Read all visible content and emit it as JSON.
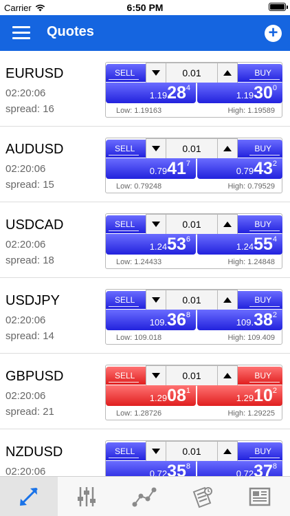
{
  "status_bar": {
    "carrier": "Carrier",
    "time": "6:50 PM"
  },
  "header": {
    "title": "Quotes",
    "menu_icon": "hamburger-menu-icon",
    "add_icon": "plus-circle-icon"
  },
  "colors": {
    "header": "#1565e0",
    "blue_button": "#2b2be8",
    "red_button": "#e83535"
  },
  "panel_labels": {
    "sell": "SELL",
    "buy": "BUY",
    "low_prefix": "Low: ",
    "high_prefix": "High: "
  },
  "quotes": [
    {
      "symbol": "EURUSD",
      "time": "02:20:06",
      "spread": "spread: 16",
      "lot": "0.01",
      "sell": {
        "pre": "1.19",
        "big": "28",
        "sup": "4"
      },
      "buy": {
        "pre": "1.19",
        "big": "30",
        "sup": "0"
      },
      "low": "1.19163",
      "high": "1.19589",
      "color": "blue"
    },
    {
      "symbol": "AUDUSD",
      "time": "02:20:06",
      "spread": "spread: 15",
      "lot": "0.01",
      "sell": {
        "pre": "0.79",
        "big": "41",
        "sup": "7"
      },
      "buy": {
        "pre": "0.79",
        "big": "43",
        "sup": "2"
      },
      "low": "0.79248",
      "high": "0.79529",
      "color": "blue"
    },
    {
      "symbol": "USDCAD",
      "time": "02:20:06",
      "spread": "spread: 18",
      "lot": "0.01",
      "sell": {
        "pre": "1.24",
        "big": "53",
        "sup": "6"
      },
      "buy": {
        "pre": "1.24",
        "big": "55",
        "sup": "4"
      },
      "low": "1.24433",
      "high": "1.24848",
      "color": "blue"
    },
    {
      "symbol": "USDJPY",
      "time": "02:20:06",
      "spread": "spread: 14",
      "lot": "0.01",
      "sell": {
        "pre": "109.",
        "big": "36",
        "sup": "8"
      },
      "buy": {
        "pre": "109.",
        "big": "38",
        "sup": "2"
      },
      "low": "109.018",
      "high": "109.409",
      "color": "blue"
    },
    {
      "symbol": "GBPUSD",
      "time": "02:20:06",
      "spread": "spread: 21",
      "lot": "0.01",
      "sell": {
        "pre": "1.29",
        "big": "08",
        "sup": "1"
      },
      "buy": {
        "pre": "1.29",
        "big": "10",
        "sup": "2"
      },
      "low": "1.28726",
      "high": "1.29225",
      "color": "red"
    },
    {
      "symbol": "NZDUSD",
      "time": "02:20:06",
      "spread": "",
      "lot": "0.01",
      "sell": {
        "pre": "0.72",
        "big": "35",
        "sup": "8"
      },
      "buy": {
        "pre": "0.72",
        "big": "37",
        "sup": "8"
      },
      "low": "",
      "high": "",
      "color": "blue"
    }
  ],
  "tabs": [
    {
      "name": "tab-quotes",
      "icon": "swap-arrows-icon",
      "active": true
    },
    {
      "name": "tab-trade",
      "icon": "sliders-icon",
      "active": false
    },
    {
      "name": "tab-chart",
      "icon": "line-chart-icon",
      "active": false
    },
    {
      "name": "tab-history",
      "icon": "history-doc-icon",
      "active": false
    },
    {
      "name": "tab-news",
      "icon": "newspaper-icon",
      "active": false
    }
  ]
}
